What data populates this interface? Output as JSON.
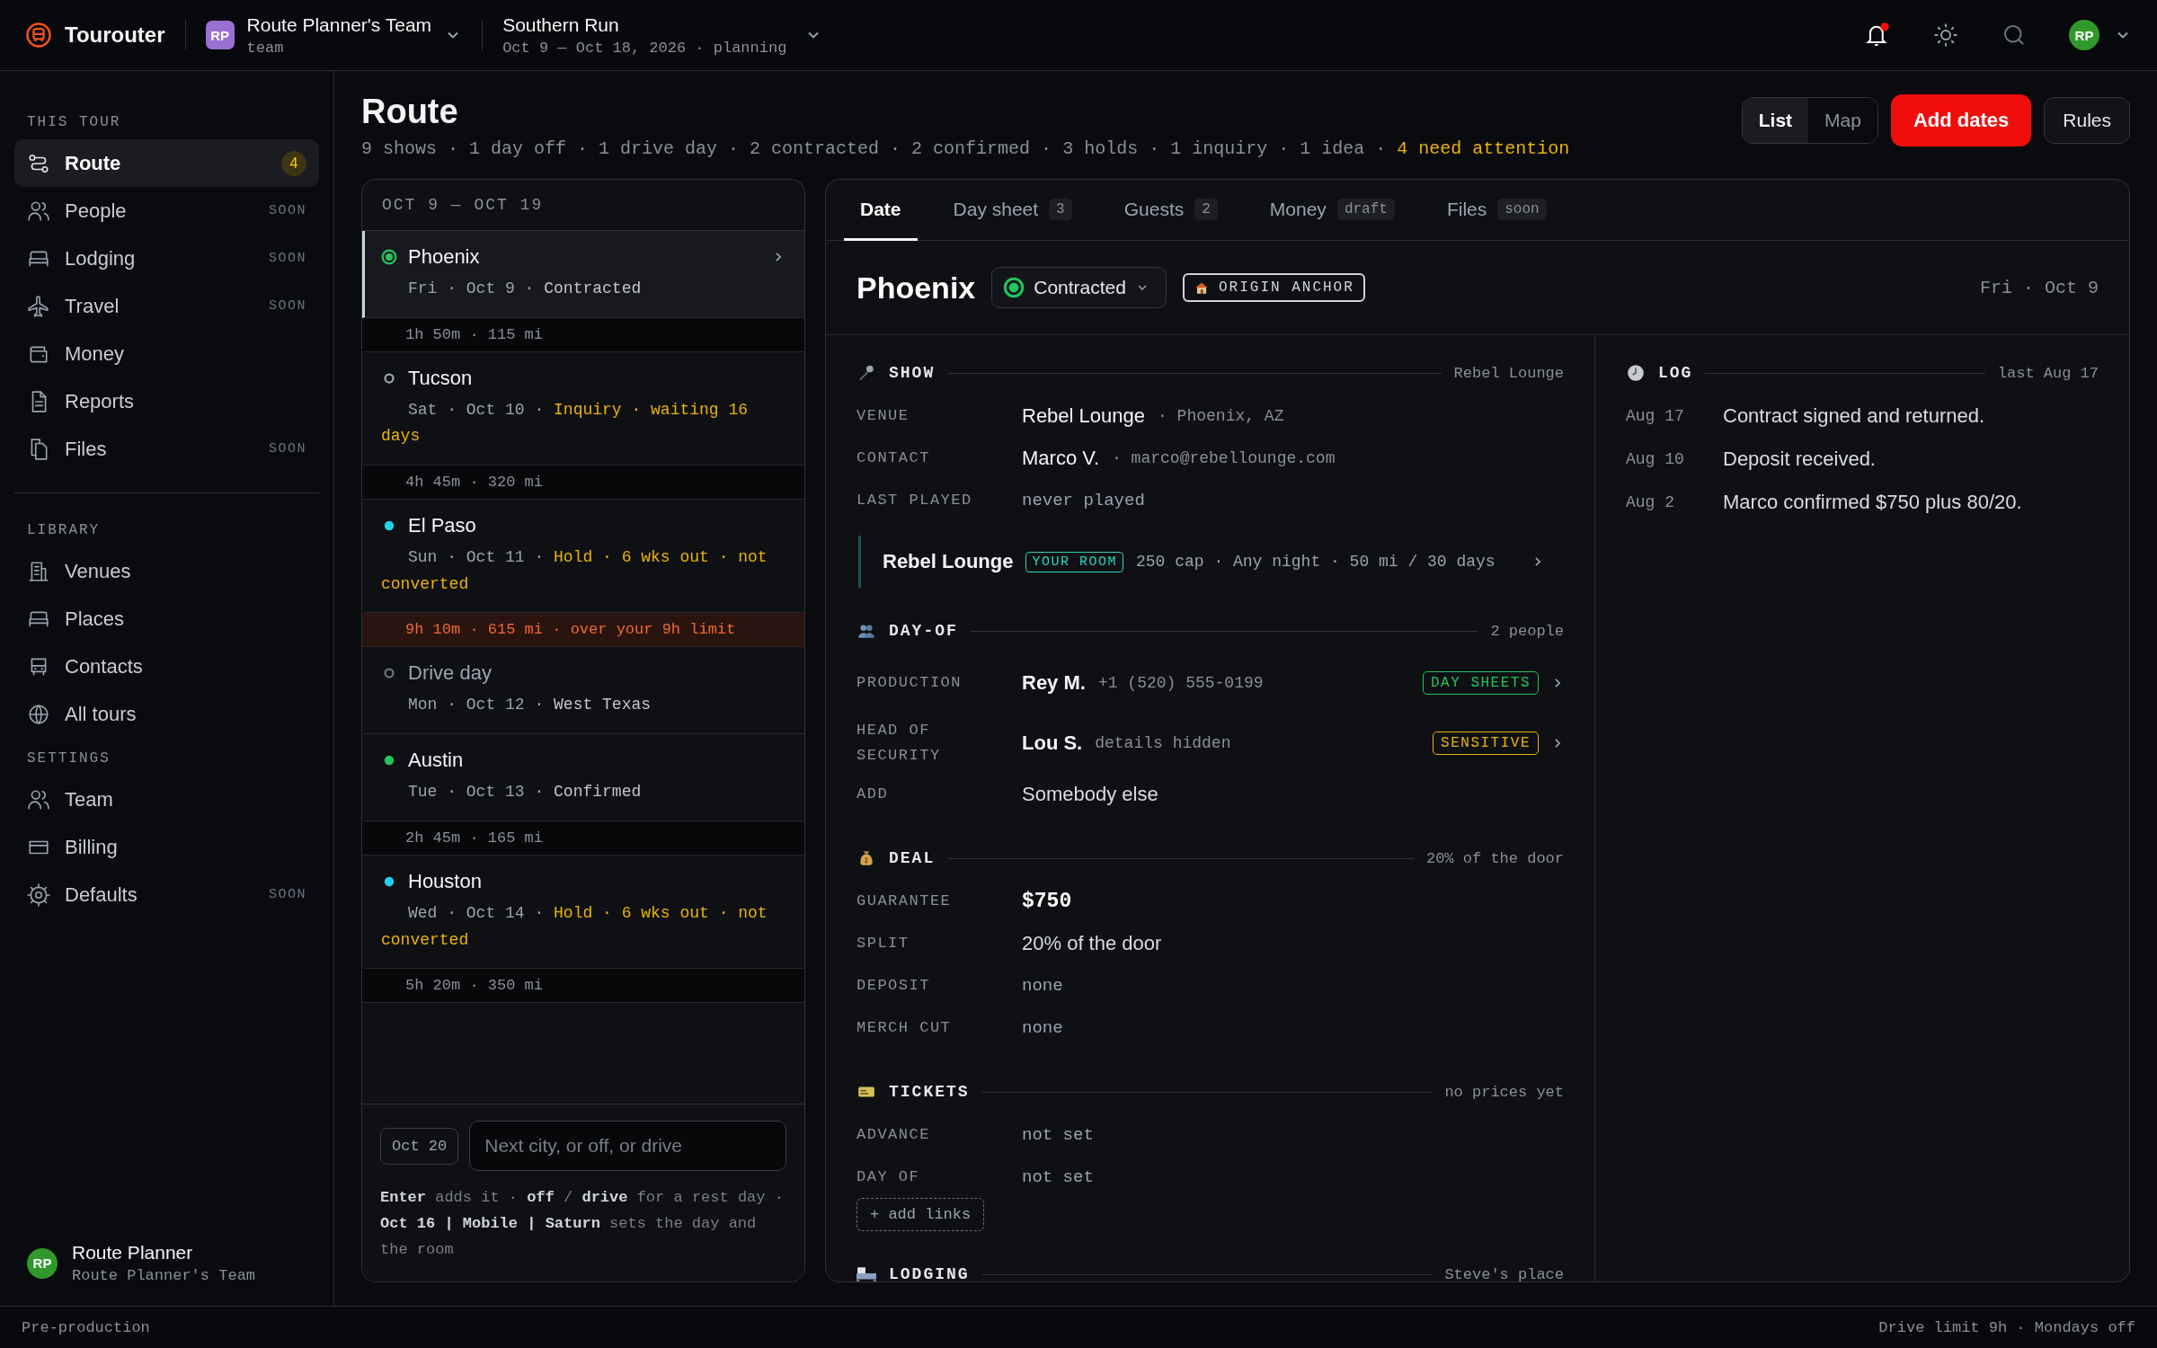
{
  "topbar": {
    "brand": "Tourouter",
    "team": {
      "initials": "RP",
      "name": "Route Planner's Team",
      "sub": "team"
    },
    "tour": {
      "name": "Southern Run",
      "sub": "Oct 9 — Oct 18, 2026 · planning"
    },
    "notifications": {
      "unread": true
    },
    "user": {
      "initials": "RP"
    }
  },
  "sidebar": {
    "sections": [
      {
        "title": "THIS TOUR",
        "divider": true,
        "items": [
          {
            "label": "Route",
            "badge": "4",
            "selected": true
          },
          {
            "label": "People",
            "tag": "SOON",
            "selected": false
          },
          {
            "label": "Lodging",
            "tag": "SOON",
            "selected": false
          },
          {
            "label": "Travel",
            "tag": "SOON",
            "selected": false
          },
          {
            "label": "Money",
            "selected": false
          },
          {
            "label": "Reports",
            "selected": false
          },
          {
            "label": "Files",
            "tag": "SOON",
            "selected": false
          }
        ]
      },
      {
        "title": "LIBRARY",
        "divider": false,
        "items": [
          {
            "label": "Venues",
            "selected": false
          },
          {
            "label": "Places",
            "selected": false
          },
          {
            "label": "Contacts",
            "selected": false
          },
          {
            "label": "All tours",
            "selected": false
          }
        ]
      },
      {
        "title": "SETTINGS",
        "divider": false,
        "items": [
          {
            "label": "Team",
            "selected": false
          },
          {
            "label": "Billing",
            "selected": false
          },
          {
            "label": "Defaults",
            "tag": "SOON",
            "selected": false
          }
        ]
      }
    ],
    "user": {
      "initials": "RP",
      "name": "Route Planner",
      "team": "Route Planner's Team"
    }
  },
  "page": {
    "title": "Route",
    "summary": "9 shows · 1 day off · 1 drive day · 2 contracted · 2 confirmed · 3 holds · 1 inquiry · 1 idea · ",
    "alert": "4 need attention",
    "views": [
      {
        "label": "List",
        "selected": true
      },
      {
        "label": "Map",
        "selected": false
      }
    ],
    "buttons": [
      {
        "label": "Add dates",
        "kind": "primary"
      },
      {
        "label": "Rules",
        "kind": "secondary"
      }
    ]
  },
  "route": {
    "range": "OCT 9 — OCT 19",
    "stops": [
      {
        "kind": "show",
        "name": "Phoenix",
        "color": "#22c55e",
        "meta": "Fri · Oct 9 · ",
        "status": "Contracted",
        "attention": false,
        "selected": true
      },
      {
        "kind": "leg",
        "text": "1h 50m · 115 mi",
        "warning": false
      },
      {
        "kind": "inquiry",
        "name": "Tucson",
        "color": "#9ca3af",
        "meta": "Sat · Oct 10 · ",
        "status": "Inquiry · waiting 16 days",
        "attention": true,
        "selected": false
      },
      {
        "kind": "leg",
        "text": "4h 45m · 320 mi",
        "warning": false
      },
      {
        "kind": "show",
        "name": "El Paso",
        "color": "#22d3ee",
        "meta": "Sun · Oct 11 · ",
        "status": "Hold · 6 wks out · not converted",
        "attention": true,
        "selected": false
      },
      {
        "kind": "leg",
        "text": "9h 10m · 615 mi · over your 9h limit",
        "warning": true
      },
      {
        "kind": "drive",
        "name": "Drive day",
        "color": "#6b7280",
        "meta": "Mon · Oct 12 · ",
        "status": "West Texas",
        "attention": false,
        "selected": false
      },
      {
        "kind": "show",
        "name": "Austin",
        "color": "#22c55e",
        "meta": "Tue · Oct 13 · ",
        "status": "Confirmed",
        "attention": false,
        "selected": false
      },
      {
        "kind": "leg",
        "text": "2h 45m · 165 mi",
        "warning": false
      },
      {
        "kind": "show",
        "name": "Houston",
        "color": "#22d3ee",
        "meta": "Wed · Oct 14 · ",
        "status": "Hold · 6 wks out · not converted",
        "attention": true,
        "selected": false
      },
      {
        "kind": "leg",
        "text": "5h 20m · 350 mi",
        "warning": false
      }
    ],
    "composer": {
      "date": "Oct 20",
      "placeholder": "Next city, or off, or drive",
      "help": "**Enter** adds it · **off** / **drive** for a rest day · **Oct 16 | Mobile | Saturn** sets the day and the room"
    }
  },
  "detail": {
    "tabs": [
      {
        "label": "Date",
        "selected": true
      },
      {
        "label": "Day sheet",
        "badge": "3",
        "selected": false
      },
      {
        "label": "Guests",
        "badge": "2",
        "selected": false
      },
      {
        "label": "Money",
        "badge": "draft",
        "selected": false
      },
      {
        "label": "Files",
        "badge": "soon",
        "selected": false
      }
    ],
    "title": "Phoenix",
    "status": {
      "label": "Contracted",
      "color": "#22c55e"
    },
    "anchor": "ORIGIN ANCHOR",
    "date": "Fri · Oct 9",
    "sections": [
      {
        "kind": "show",
        "title": "SHOW",
        "note": "Rebel Lounge",
        "rows": [
          {
            "kind": "name",
            "label": "VENUE",
            "value": "Rebel Lounge",
            "detail": "· Phoenix, AZ"
          },
          {
            "kind": "name",
            "label": "CONTACT",
            "value": "Marco V.",
            "detail": "· marco@rebellounge.com"
          },
          {
            "kind": "muted",
            "label": "LAST PLAYED",
            "value": "never played"
          },
          {
            "kind": "room",
            "name": "Rebel Lounge",
            "tag": "YOUR ROOM",
            "detail": "250 cap · Any night · 50 mi / 30 days"
          }
        ]
      },
      {
        "kind": "people",
        "title": "DAY-OF",
        "note": "2 people",
        "rows": [
          {
            "kind": "person",
            "label": "PRODUCTION",
            "value": "Rey M.",
            "detail": "+1 (520) 555-0199",
            "tag": {
              "text": "DAY SHEETS",
              "color": "#22c55e"
            }
          },
          {
            "kind": "person",
            "label": "HEAD OF SECURITY",
            "value": "Lou S.",
            "detail": "details hidden",
            "tag": {
              "text": "SENSITIVE",
              "color": "#eab308"
            }
          },
          {
            "kind": "plain",
            "label": "ADD",
            "value": "Somebody else"
          }
        ]
      },
      {
        "kind": "deal",
        "title": "DEAL",
        "note": "20% of the door",
        "rows": [
          {
            "kind": "money",
            "label": "GUARANTEE",
            "value": "$750"
          },
          {
            "kind": "plain",
            "label": "SPLIT",
            "value": "20% of the door"
          },
          {
            "kind": "muted",
            "label": "DEPOSIT",
            "value": "none"
          },
          {
            "kind": "muted",
            "label": "MERCH CUT",
            "value": "none"
          }
        ]
      },
      {
        "kind": "tickets",
        "title": "TICKETS",
        "note": "no prices yet",
        "rows": [
          {
            "kind": "muted",
            "label": "ADVANCE",
            "value": "not set"
          },
          {
            "kind": "muted",
            "label": "DAY OF",
            "value": "not set"
          },
          {
            "kind": "action",
            "label": "+ add links"
          }
        ]
      },
      {
        "kind": "lodging",
        "title": "LODGING",
        "note": "Steve's place"
      }
    ],
    "log": {
      "title": "LOG",
      "note": "last Aug 17",
      "entries": [
        {
          "date": "Aug 17",
          "text": "Contract signed and returned."
        },
        {
          "date": "Aug 10",
          "text": "Deposit received."
        },
        {
          "date": "Aug 2",
          "text": "Marco confirmed $750 plus 80/20."
        }
      ]
    }
  },
  "status_bar": {
    "left": "Pre-production",
    "right": "Drive limit 9h · Mondays off"
  }
}
